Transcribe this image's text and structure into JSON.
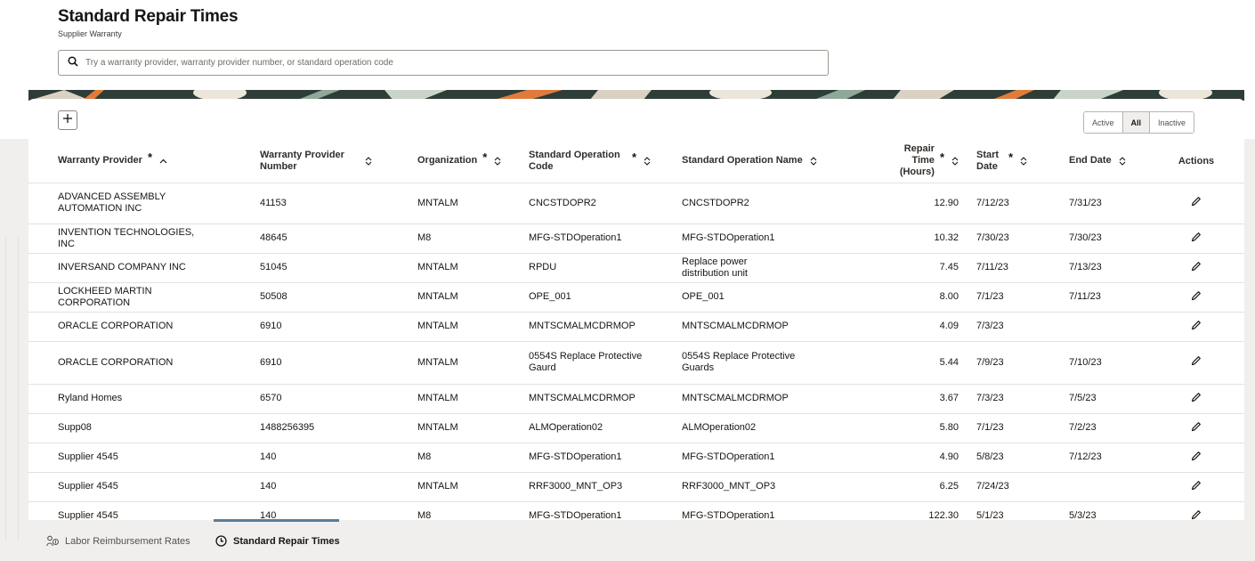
{
  "page": {
    "title": "Standard Repair Times",
    "subtitle": "Supplier Warranty"
  },
  "search": {
    "icon": "search-icon",
    "placeholder": "Try a warranty provider, warranty provider number, or standard operation code",
    "value": ""
  },
  "toolbar": {
    "add_icon": "plus-icon",
    "filter_options": [
      "Active",
      "All",
      "Inactive"
    ],
    "filter_selected": "All"
  },
  "table": {
    "columns": [
      {
        "label": "Warranty Provider",
        "required": true,
        "sort": "asc"
      },
      {
        "label": "Warranty Provider Number",
        "required": false,
        "sort": "none"
      },
      {
        "label": "Organization",
        "required": true,
        "sort": "none"
      },
      {
        "label": "Standard Operation Code",
        "required": true,
        "sort": "none"
      },
      {
        "label": "Standard Operation Name",
        "required": false,
        "sort": "none"
      },
      {
        "label": "Repair Time (Hours)",
        "required": true,
        "sort": "none"
      },
      {
        "label": "Start Date",
        "required": true,
        "sort": "none"
      },
      {
        "label": "End Date",
        "required": false,
        "sort": "none"
      },
      {
        "label": "Actions",
        "required": false,
        "sort": null
      }
    ],
    "rows": [
      {
        "provider": "ADVANCED ASSEMBLY AUTOMATION INC",
        "number": "41153",
        "org": "MNTALM",
        "code": "CNCSTDOPR2",
        "name": "CNCSTDOPR2",
        "hours": "12.90",
        "start": "7/12/23",
        "end": "7/31/23"
      },
      {
        "provider": "INVENTION TECHNOLOGIES, INC",
        "number": "48645",
        "org": "M8",
        "code": "MFG-STDOperation1",
        "name": "MFG-STDOperation1",
        "hours": "10.32",
        "start": "7/30/23",
        "end": "7/30/23"
      },
      {
        "provider": "INVERSAND COMPANY INC",
        "number": "51045",
        "org": "MNTALM",
        "code": "RPDU",
        "name": "Replace power distribution unit",
        "hours": "7.45",
        "start": "7/11/23",
        "end": "7/13/23"
      },
      {
        "provider": "LOCKHEED MARTIN CORPORATION",
        "number": "50508",
        "org": "MNTALM",
        "code": "OPE_001",
        "name": "OPE_001",
        "hours": "8.00",
        "start": "7/1/23",
        "end": "7/11/23"
      },
      {
        "provider": "ORACLE CORPORATION",
        "number": "6910",
        "org": "MNTALM",
        "code": "MNTSCMALMCDRMOP",
        "name": "MNTSCMALMCDRMOP",
        "hours": "4.09",
        "start": "7/3/23",
        "end": ""
      },
      {
        "provider": "ORACLE CORPORATION",
        "number": "6910",
        "org": "MNTALM",
        "code": "0554S Replace Protective Gaurd",
        "name": "0554S Replace Protective Guards",
        "hours": "5.44",
        "start": "7/9/23",
        "end": "7/10/23"
      },
      {
        "provider": "Ryland Homes",
        "number": "6570",
        "org": "MNTALM",
        "code": "MNTSCMALMCDRMOP",
        "name": "MNTSCMALMCDRMOP",
        "hours": "3.67",
        "start": "7/3/23",
        "end": "7/5/23"
      },
      {
        "provider": "Supp08",
        "number": "1488256395",
        "org": "MNTALM",
        "code": "ALMOperation02",
        "name": "ALMOperation02",
        "hours": "5.80",
        "start": "7/1/23",
        "end": "7/2/23"
      },
      {
        "provider": "Supplier 4545",
        "number": "140",
        "org": "M8",
        "code": "MFG-STDOperation1",
        "name": "MFG-STDOperation1",
        "hours": "4.90",
        "start": "5/8/23",
        "end": "7/12/23"
      },
      {
        "provider": "Supplier 4545",
        "number": "140",
        "org": "MNTALM",
        "code": "RRF3000_MNT_OP3",
        "name": "RRF3000_MNT_OP3",
        "hours": "6.25",
        "start": "7/24/23",
        "end": ""
      },
      {
        "provider": "Supplier 4545",
        "number": "140",
        "org": "M8",
        "code": "MFG-STDOperation1",
        "name": "MFG-STDOperation1",
        "hours": "122.30",
        "start": "5/1/23",
        "end": "5/3/23"
      }
    ],
    "row_action_icon": "pencil-icon"
  },
  "bottom_tabs": [
    {
      "label": "Labor Reimbursement Rates",
      "icon": "labor-rates-icon",
      "active": false
    },
    {
      "label": "Standard Repair Times",
      "icon": "clock-icon",
      "active": true
    }
  ]
}
